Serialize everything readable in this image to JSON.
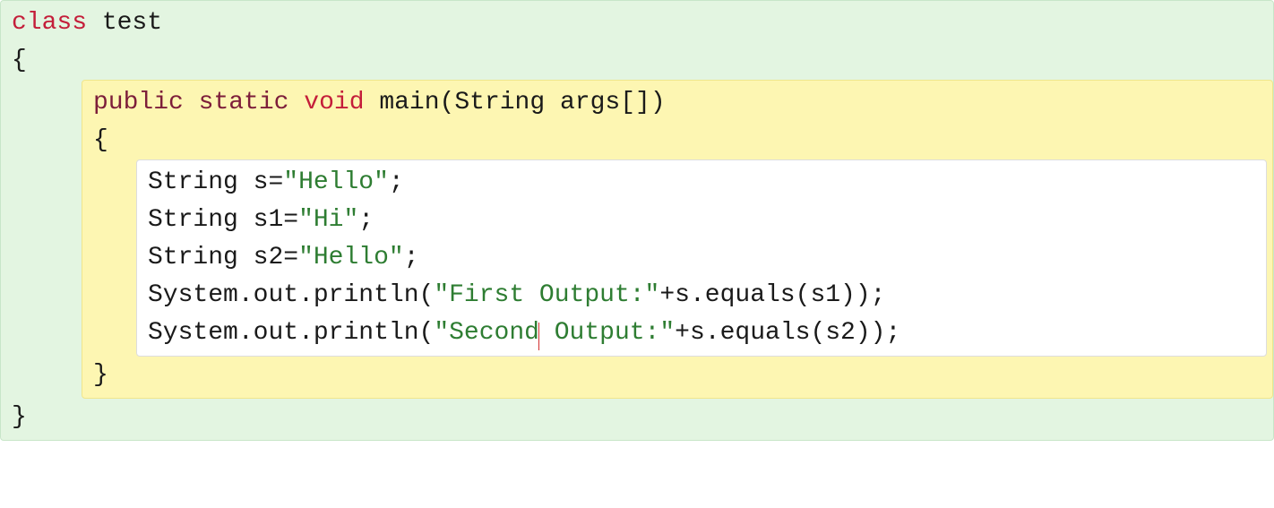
{
  "code": {
    "keywords": {
      "class": "class",
      "public": "public",
      "static": "static",
      "void": "void"
    },
    "identifiers": {
      "test": "test",
      "main": "main",
      "String": "String",
      "args": "args",
      "s": "s",
      "s1": "s1",
      "s2": "s2",
      "System": "System",
      "out": "out",
      "println": "println",
      "equals": "equals"
    },
    "strings": {
      "hello": "\"Hello\"",
      "hi": "\"Hi\"",
      "firstOutput": "\"First Output:\"",
      "secondPart1": "\"Second",
      "secondPart2": " Output:\""
    },
    "punct": {
      "openBrace": "{",
      "closeBrace": "}",
      "openParen": "(",
      "closeParen": ")",
      "openBracket": "[",
      "closeBracket": "]",
      "semicolon": ";",
      "equals": "=",
      "plus": "+",
      "dot": ".",
      "space": " "
    }
  },
  "colors": {
    "classBg": "#e3f5e1",
    "methodBg": "#fdf6b2",
    "bodyBg": "#ffffff",
    "keywordRed": "#c41e3a",
    "keywordDark": "#7d1e3a",
    "stringGreen": "#2e7d32",
    "cursorRed": "#d32f2f"
  }
}
